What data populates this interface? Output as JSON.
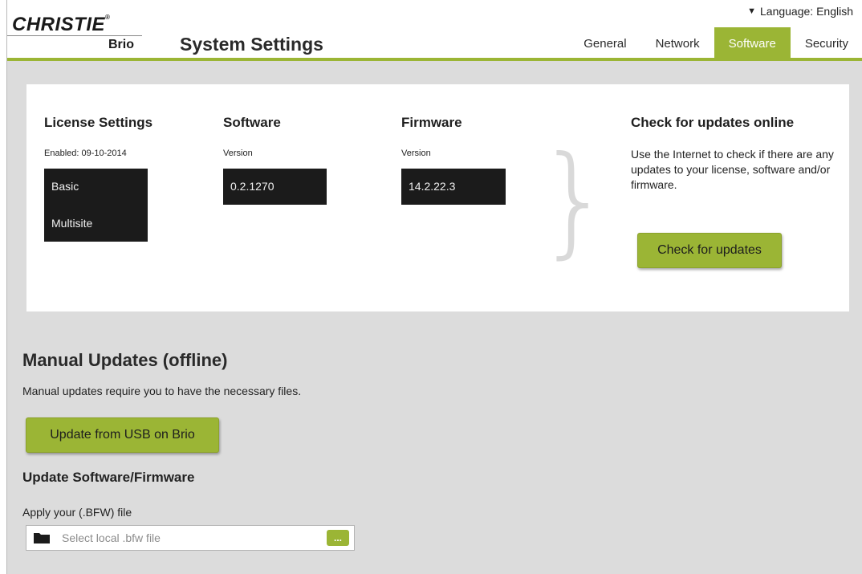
{
  "brand": {
    "logo": "CHRISTIE",
    "product": "Brio"
  },
  "page_title": "System Settings",
  "language": {
    "label": "Language: English"
  },
  "tabs": [
    {
      "label": "General"
    },
    {
      "label": "Network"
    },
    {
      "label": "Software",
      "active": true
    },
    {
      "label": "Security"
    }
  ],
  "license": {
    "title": "License Settings",
    "enabled": "Enabled: 09-10-2014",
    "items": [
      "Basic",
      "Multisite"
    ]
  },
  "software": {
    "title": "Software",
    "version_label": "Version",
    "version": "0.2.1270"
  },
  "firmware": {
    "title": "Firmware",
    "version_label": "Version",
    "version": "14.2.22.3"
  },
  "online": {
    "title": "Check for updates online",
    "description": "Use the Internet to check if there are any updates to your license, software and/or firmware.",
    "button": "Check for updates"
  },
  "manual": {
    "title": "Manual Updates (offline)",
    "description": "Manual updates require you to have the necessary files.",
    "usb_button": "Update from USB on Brio",
    "subtitle": "Update Software/Firmware",
    "apply_label": "Apply your (.BFW) file",
    "file_placeholder": "Select local .bfw file",
    "browse_label": "..."
  },
  "colors": {
    "accent": "#9bb535",
    "panel_bg": "#dcdcdc",
    "dark_box": "#1b1b1b"
  },
  "icons": {
    "language_caret": "caret-down-icon",
    "file": "folder-icon"
  }
}
